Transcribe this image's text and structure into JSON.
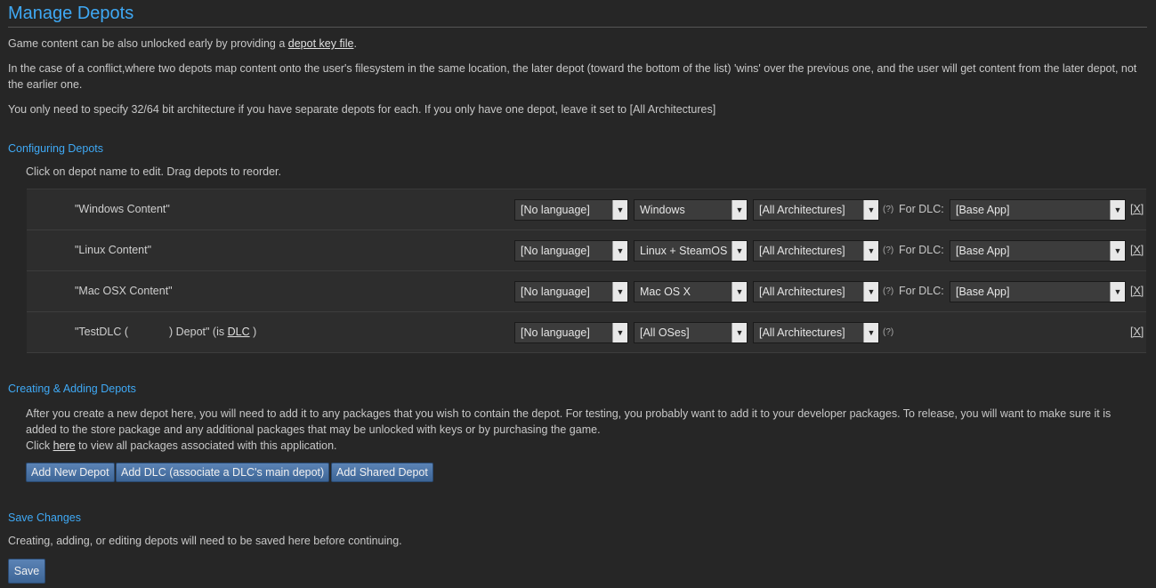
{
  "page_title": "Manage Depots",
  "intro": {
    "line1_text": "Game content can be also unlocked early by providing a ",
    "line1_link": "depot key file",
    "line1_end": ".",
    "line2": "In the case of a conflict,where two depots map content onto the user's filesystem in the same location, the later depot (toward the bottom of the list) 'wins' over the previous one, and the user will get content from the later depot, not the earlier one.",
    "line3": "You only need to specify 32/64 bit architecture if you have separate depots for each. If you only have one depot, leave it set to [All Architectures]"
  },
  "configuring": {
    "heading": "Configuring Depots",
    "instructions": "Click on depot name to edit. Drag depots to reorder."
  },
  "depots": [
    {
      "name": "\"Windows Content\"",
      "language": "[No language]",
      "os": "Windows",
      "arch": "[All Architectures]",
      "help": "(?)",
      "for_dlc_label": "For DLC:",
      "dlc": "[Base App]",
      "remove": "[X]"
    },
    {
      "name": "\"Linux Content\"",
      "language": "[No language]",
      "os": "Linux + SteamOS",
      "arch": "[All Architectures]",
      "help": "(?)",
      "for_dlc_label": "For DLC:",
      "dlc": "[Base App]",
      "remove": "[X]"
    },
    {
      "name": "\"Mac OSX Content\"",
      "language": "[No language]",
      "os": "Mac OS X",
      "arch": "[All Architectures]",
      "help": "(?)",
      "for_dlc_label": "For DLC:",
      "dlc": "[Base App]",
      "remove": "[X]"
    },
    {
      "name_prefix": "\"TestDLC (",
      "name_mid": ") Depot\" (is ",
      "name_link": "DLC",
      "name_suffix": " )",
      "language": "[No language]",
      "os": "[All OSes]",
      "arch": "[All Architectures]",
      "help": "(?)",
      "remove": "[X]"
    }
  ],
  "creating": {
    "heading": "Creating & Adding Depots",
    "text1": "After you create a new depot here, you will need to add it to any packages that you wish to contain the depot. For testing, you probably want to add it to your developer packages. To release, you will want to make sure it is added to the store package and any additional packages that may be unlocked with keys or by purchasing the game.",
    "click_prefix": "Click ",
    "click_link": "here",
    "click_suffix": " to view all packages associated with this application.",
    "buttons": [
      "Add New Depot",
      "Add DLC (associate a DLC's main depot)",
      "Add Shared Depot"
    ]
  },
  "save_changes": {
    "heading": "Save Changes",
    "text": "Creating, adding, or editing depots will need to be saved here before continuing.",
    "button": "Save"
  },
  "icons": {
    "dropdown_arrow": "chevron-down-icon"
  },
  "colors": {
    "accent": "#3fa9f5",
    "background": "#262626",
    "button": "#4a72a5"
  }
}
